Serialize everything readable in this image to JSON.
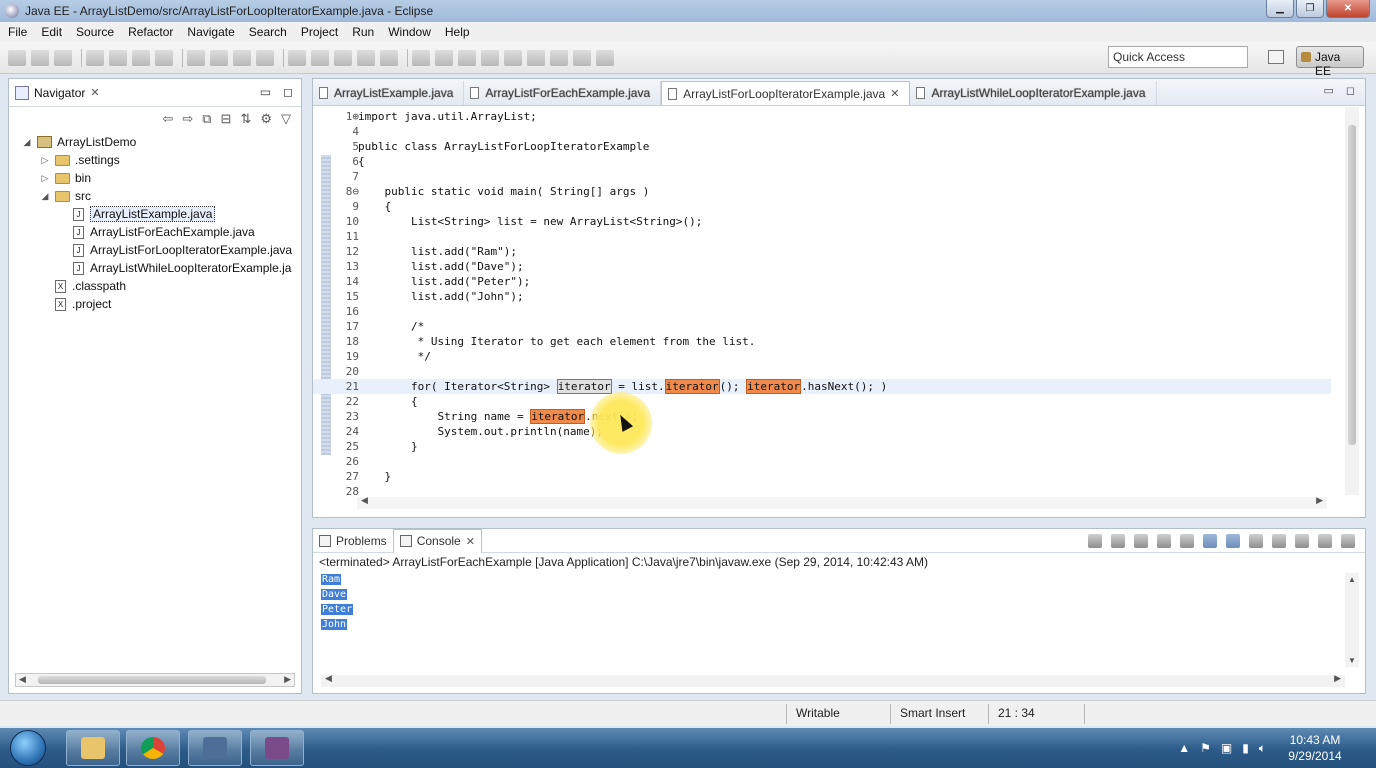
{
  "window": {
    "title": "Java EE - ArrayListDemo/src/ArrayListForLoopIteratorExample.java - Eclipse"
  },
  "menu": [
    "File",
    "Edit",
    "Source",
    "Refactor",
    "Navigate",
    "Search",
    "Project",
    "Run",
    "Window",
    "Help"
  ],
  "toolbar": {
    "quick_access_placeholder": "Quick Access",
    "perspective_label": "Java EE"
  },
  "navigator": {
    "tab_label": "Navigator",
    "tree": [
      {
        "label": "ArrayListDemo",
        "kind": "project",
        "depth": 0,
        "twisty": "◢"
      },
      {
        "label": ".settings",
        "kind": "folder",
        "depth": 1,
        "twisty": "▷"
      },
      {
        "label": "bin",
        "kind": "folder",
        "depth": 1,
        "twisty": "▷"
      },
      {
        "label": "src",
        "kind": "folder",
        "depth": 1,
        "twisty": "◢"
      },
      {
        "label": "ArrayListExample.java",
        "kind": "java",
        "depth": 2,
        "selected": true
      },
      {
        "label": "ArrayListForEachExample.java",
        "kind": "java",
        "depth": 2
      },
      {
        "label": "ArrayListForLoopIteratorExample.java",
        "kind": "java",
        "depth": 2
      },
      {
        "label": "ArrayListWhileLoopIteratorExample.ja",
        "kind": "java",
        "depth": 2
      },
      {
        "label": ".classpath",
        "kind": "x",
        "depth": 1
      },
      {
        "label": ".project",
        "kind": "x",
        "depth": 1
      }
    ]
  },
  "editor": {
    "tabs": [
      {
        "label": "ArrayListExample.java",
        "active": false
      },
      {
        "label": "ArrayListForEachExample.java",
        "active": false
      },
      {
        "label": "ArrayListForLoopIteratorExample.java",
        "active": true
      },
      {
        "label": "ArrayListWhileLoopIteratorExample.java",
        "active": false
      }
    ],
    "lines": [
      {
        "n": "1⊕",
        "code": "import java.util.ArrayList;"
      },
      {
        "n": "4",
        "code": ""
      },
      {
        "n": "5",
        "code": "public class ArrayListForLoopIteratorExample"
      },
      {
        "n": "6",
        "code": "{"
      },
      {
        "n": "7",
        "code": ""
      },
      {
        "n": "8⊖",
        "code": "    public static void main( String[] args )"
      },
      {
        "n": "9",
        "code": "    {"
      },
      {
        "n": "10",
        "code": "        List<String> list = new ArrayList<String>();"
      },
      {
        "n": "11",
        "code": ""
      },
      {
        "n": "12",
        "code": "        list.add(\"Ram\");"
      },
      {
        "n": "13",
        "code": "        list.add(\"Dave\");"
      },
      {
        "n": "14",
        "code": "        list.add(\"Peter\");"
      },
      {
        "n": "15",
        "code": "        list.add(\"John\");"
      },
      {
        "n": "16",
        "code": ""
      },
      {
        "n": "17",
        "code": "        /*"
      },
      {
        "n": "18",
        "code": "         * Using Iterator to get each element from the list."
      },
      {
        "n": "19",
        "code": "         */"
      },
      {
        "n": "20",
        "code": ""
      },
      {
        "n": "21",
        "code": "        for( Iterator<String> iterator = list.iterator(); iterator.hasNext(); )"
      },
      {
        "n": "22",
        "code": "        {"
      },
      {
        "n": "23",
        "code": "            String name = iterator.next();"
      },
      {
        "n": "24",
        "code": "            System.out.println(name);"
      },
      {
        "n": "25",
        "code": "        }"
      },
      {
        "n": "26",
        "code": ""
      },
      {
        "n": "27",
        "code": "    }"
      },
      {
        "n": "28",
        "code": ""
      }
    ],
    "current_line": "21"
  },
  "console": {
    "tabs": [
      "Problems",
      "Console"
    ],
    "status": "<terminated> ArrayListForEachExample [Java Application] C:\\Java\\jre7\\bin\\javaw.exe (Sep 29, 2014, 10:42:43 AM)",
    "output": [
      "Ram",
      "Dave",
      "Peter",
      "John"
    ]
  },
  "statusbar": {
    "writable": "Writable",
    "insert_mode": "Smart Insert",
    "position": "21 : 34"
  },
  "taskbar": {
    "time": "10:43 AM",
    "date": "9/29/2014"
  }
}
